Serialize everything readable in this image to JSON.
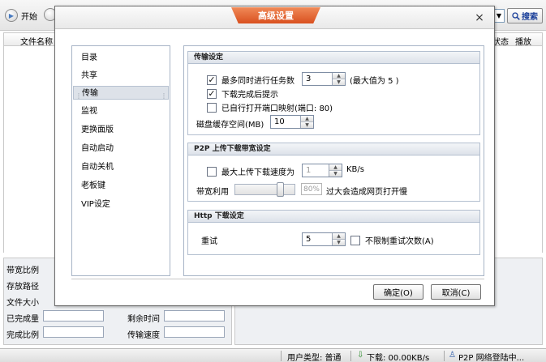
{
  "toolbar": {
    "start_label": "开始",
    "search_label": "搜索"
  },
  "list": {
    "columns": {
      "name": "文件名称",
      "status": "状态",
      "play": "播放"
    }
  },
  "info": {
    "bandwidth_ratio": "带宽比例",
    "save_path": "存放路径",
    "file_size": "文件大小",
    "completed": "已完成量",
    "remaining_time": "剩余时间",
    "completion_ratio": "完成比例",
    "transfer_speed": "传输速度"
  },
  "statusbar": {
    "user_type": "用户类型: 普通",
    "download": "下载: 00.00KB/s",
    "p2p": "P2P 网络登陆中..."
  },
  "dialog": {
    "title": "高级设置",
    "close": "×",
    "nav": [
      "目录",
      "共享",
      "传输",
      "监视",
      "更换面版",
      "自动启动",
      "自动关机",
      "老板键",
      "VIP设定"
    ],
    "active_nav_index": 2,
    "transfer": {
      "title": "传输设定",
      "max_tasks_label": "最多同时进行任务数",
      "max_tasks_value": "3",
      "max_tasks_hint": "(最大值为 5 )",
      "max_tasks_checked": true,
      "download_done_label": "下载完成后提示",
      "download_done_checked": true,
      "port_map_label": "已自行打开端口映射(端口: 80)",
      "port_map_checked": false,
      "disk_cache_label": "磁盘缓存空间(MB)",
      "disk_cache_value": "10"
    },
    "p2p": {
      "title": "P2P 上传下载带宽设定",
      "max_upload_label": "最大上传下载速度为",
      "max_upload_checked": false,
      "max_upload_value": "1",
      "max_upload_unit": "KB/s",
      "bandwidth_label": "带宽利用",
      "bandwidth_value": "80%",
      "bandwidth_fraction": 0.8,
      "bandwidth_hint": "过大会造成网页打开慢"
    },
    "http": {
      "title": "Http 下载设定",
      "retry_label": "重试",
      "retry_value": "5",
      "unlimited_label": "不限制重试次数(A)",
      "unlimited_checked": false
    },
    "ok_label": "确定(O)",
    "cancel_label": "取消(C)"
  }
}
